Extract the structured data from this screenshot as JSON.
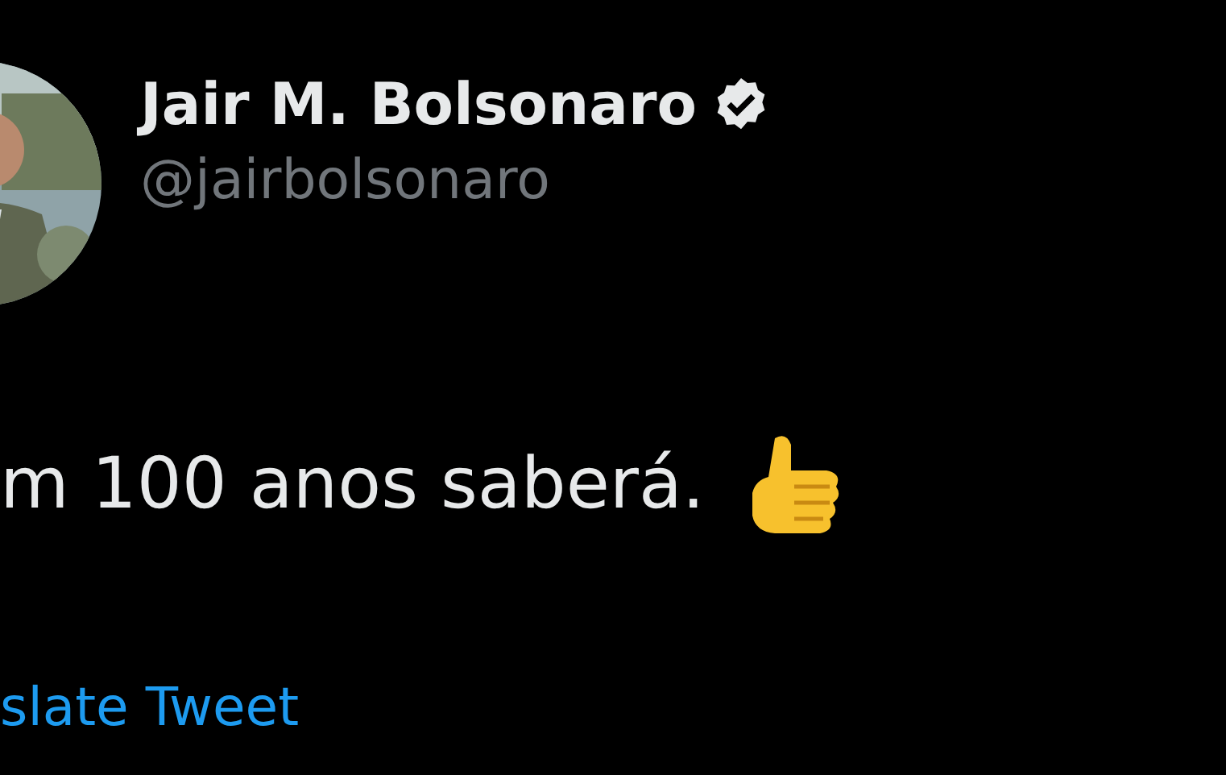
{
  "author": {
    "name": "Jair M. Bolsonaro",
    "handle": "@jairbolsonaro",
    "verified": true
  },
  "tweet": {
    "text": "m 100 anos saberá.",
    "thumbs_up_emoji": true
  },
  "translate_link": "slate Tweet"
}
